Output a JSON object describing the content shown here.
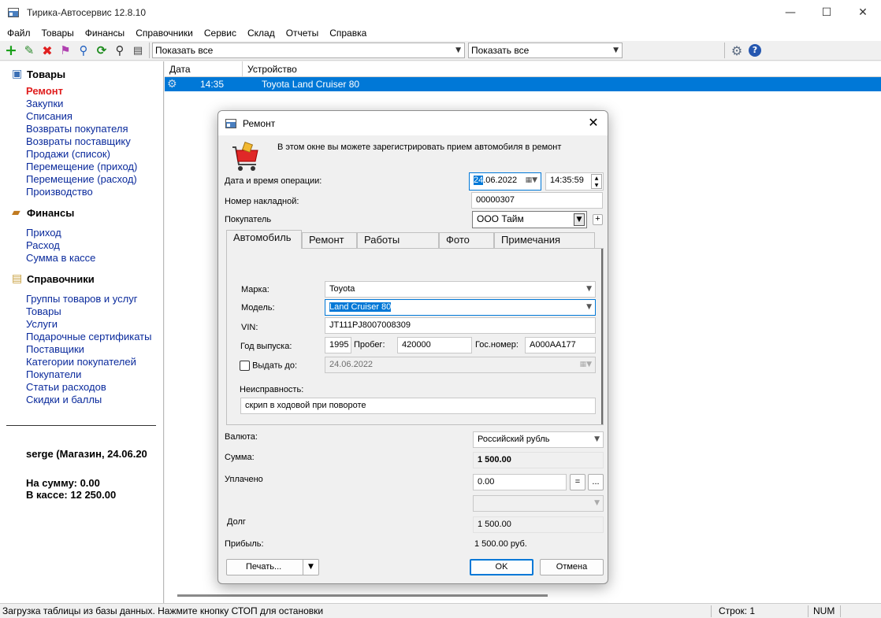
{
  "window": {
    "title": "Тирика-Автосервис 12.8.10",
    "controls": {
      "minimize": "—",
      "maximize": "☐",
      "close": "✕"
    }
  },
  "menu": [
    "Файл",
    "Товары",
    "Финансы",
    "Справочники",
    "Сервис",
    "Склад",
    "Отчеты",
    "Справка"
  ],
  "toolbar": {
    "icons": [
      "add-icon",
      "edit-icon",
      "delete-icon",
      "flag-icon",
      "link-icon",
      "refresh-icon",
      "search-icon",
      "print-icon"
    ],
    "filter1": "Показать все",
    "filter2": "Показать все",
    "colors": {
      "add": "#1aa01a",
      "edit": "#2e8b2e",
      "delete": "#e02020"
    }
  },
  "nav": {
    "sections": [
      {
        "title": "Товары",
        "icon": "box-icon",
        "items": [
          "Ремонт",
          "Закупки",
          "Списания",
          "Возвраты покупателя",
          "Возвраты поставщику",
          "Продажи (список)",
          "Перемещение (приход)",
          "Перемещение (расход)",
          "Производство"
        ]
      },
      {
        "title": "Финансы",
        "icon": "wallet-icon",
        "items": [
          "Приход",
          "Расход",
          "Сумма в кассе"
        ]
      },
      {
        "title": "Справочники",
        "icon": "books-icon",
        "items": [
          "Группы товаров и услуг",
          "Товары",
          "Услуги",
          "Подарочные сертификаты",
          "Поставщики",
          "Категории покупателей",
          "Покупатели",
          "Статьи расходов",
          "Скидки и баллы"
        ]
      }
    ],
    "user": "serge (Магазин, 24.06.20",
    "sum_label": "На сумму: 0.00",
    "cash_label": "В кассе: 12 250.00"
  },
  "grid": {
    "columns": [
      "Дата",
      "Устройство"
    ],
    "rows": [
      {
        "time": "14:35",
        "device": "Toyota Land Cruiser 80"
      }
    ]
  },
  "statusbar": {
    "message": "Загрузка таблицы из базы данных. Нажмите кнопку СТОП для остановки",
    "rows": "Строк: 1",
    "num": "NUM"
  },
  "dialog": {
    "title": "Ремонт",
    "close": "✕",
    "description": "В этом окне вы можете зарегистрировать прием автомобиля в ремонт",
    "date_label": "Дата и время операции:",
    "date_day": "24",
    "date_rest": ".06.2022",
    "time": "14:35:59",
    "invoice_label": "Номер накладной:",
    "invoice": "00000307",
    "customer_label": "Покупатель",
    "customer": "ООО Тайм",
    "add": "+",
    "tabs": [
      "Автомобиль",
      "Ремонт",
      "Работы",
      "Фото",
      "Примечания"
    ],
    "car": {
      "make_label": "Марка:",
      "make": "Toyota",
      "model_label": "Модель:",
      "model": "Land Cruiser 80",
      "vin_label": "VIN:",
      "vin": "JT111PJ8007008309",
      "year_label": "Год выпуска:",
      "year": "1995",
      "mileage_label": "Пробег:",
      "mileage": "420000",
      "plate_label": "Гос.номер:",
      "plate": "А000АА177",
      "issue_label": "Выдать до:",
      "issue_date": "24.06.2022",
      "fault_label": "Неисправность:",
      "fault": "скрип в ходовой при повороте"
    },
    "currency_label": "Валюта:",
    "currency": "Российский рубль",
    "sum_label": "Сумма:",
    "sum": "1 500.00",
    "paid_label": "Уплачено",
    "paid": "0.00",
    "eq": "=",
    "dots": "...",
    "debt_label": "Долг",
    "debt": "1 500.00",
    "profit_label": "Прибыль:",
    "profit": "1 500.00 руб.",
    "print": "Печать...",
    "ok": "OK",
    "cancel": "Отмена"
  }
}
